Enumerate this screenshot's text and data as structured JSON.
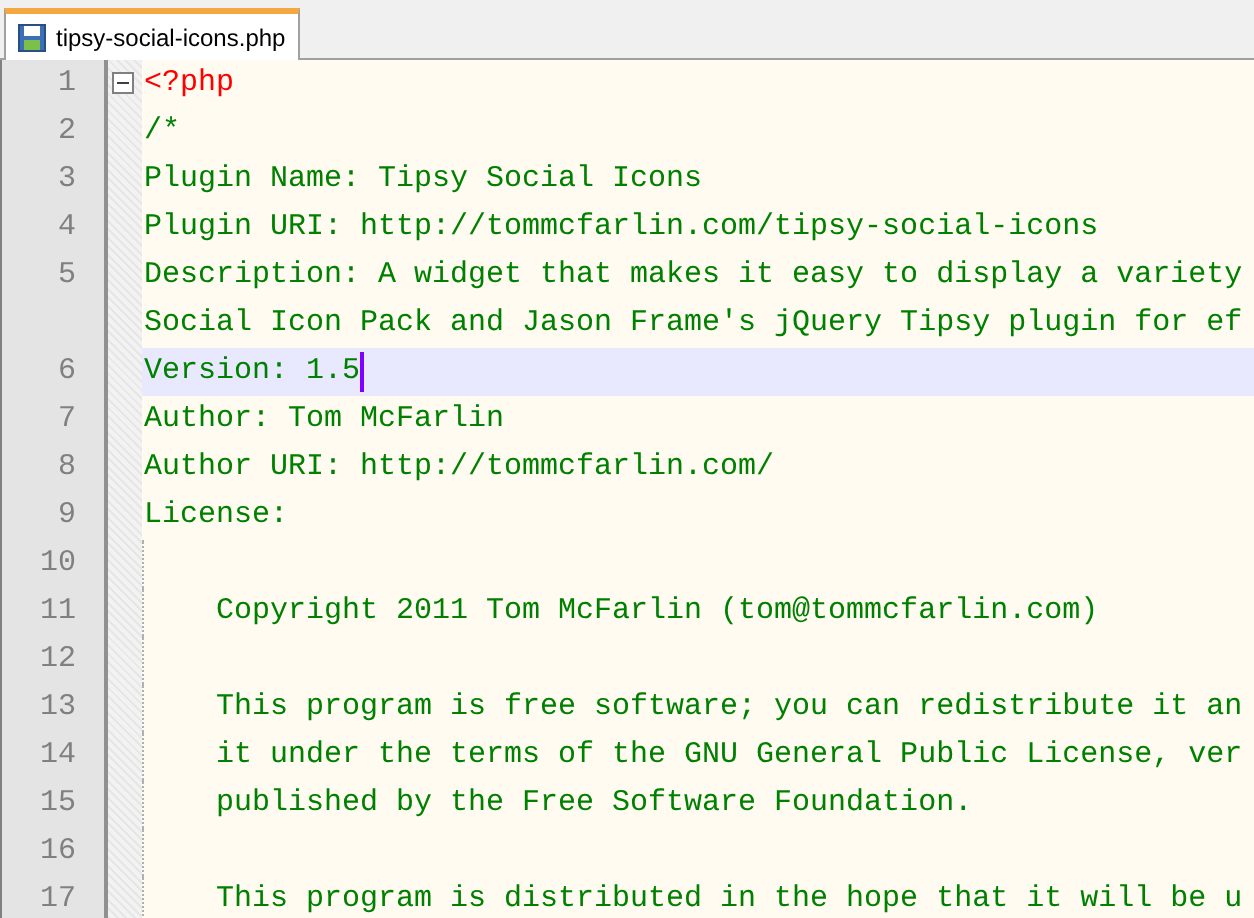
{
  "tabs": [
    {
      "label": "tipsy-social-icons.php",
      "selected": true
    }
  ],
  "lines": [
    {
      "number": "1",
      "kind": "php",
      "fold": true,
      "segments": [
        "<?php"
      ]
    },
    {
      "number": "2",
      "kind": "comment",
      "segments": [
        "/*"
      ]
    },
    {
      "number": "3",
      "kind": "comment",
      "segments": [
        "Plugin Name: Tipsy Social Icons"
      ]
    },
    {
      "number": "4",
      "kind": "comment",
      "segments": [
        "Plugin URI: http://tommcfarlin.com/tipsy-social-icons"
      ]
    },
    {
      "number": "5",
      "kind": "comment",
      "segments": [
        "Description: A widget that makes it easy to display a variety",
        "Social Icon Pack and Jason Frame's jQuery Tipsy plugin for ef"
      ]
    },
    {
      "number": "6",
      "kind": "comment",
      "current": true,
      "segments": [
        "Version: 1.5"
      ]
    },
    {
      "number": "7",
      "kind": "comment",
      "segments": [
        "Author: Tom McFarlin"
      ]
    },
    {
      "number": "8",
      "kind": "comment",
      "segments": [
        "Author URI: http://tommcfarlin.com/"
      ]
    },
    {
      "number": "9",
      "kind": "comment",
      "segments": [
        "License:"
      ]
    },
    {
      "number": "10",
      "kind": "comment",
      "guide": true
    },
    {
      "number": "11",
      "kind": "comment",
      "guide": true,
      "segments": [
        "    Copyright 2011 Tom McFarlin (tom@tommcfarlin.com)"
      ]
    },
    {
      "number": "12",
      "kind": "comment",
      "guide": true
    },
    {
      "number": "13",
      "kind": "comment",
      "guide": true,
      "segments": [
        "    This program is free software; you can redistribute it an"
      ]
    },
    {
      "number": "14",
      "kind": "comment",
      "guide": true,
      "segments": [
        "    it under the terms of the GNU General Public License, ver"
      ]
    },
    {
      "number": "15",
      "kind": "comment",
      "guide": true,
      "segments": [
        "    published by the Free Software Foundation."
      ]
    },
    {
      "number": "16",
      "kind": "comment",
      "guide": true
    },
    {
      "number": "17",
      "kind": "comment",
      "guide": true,
      "segments": [
        "    This program is distributed in the hope that it will be u"
      ]
    }
  ]
}
